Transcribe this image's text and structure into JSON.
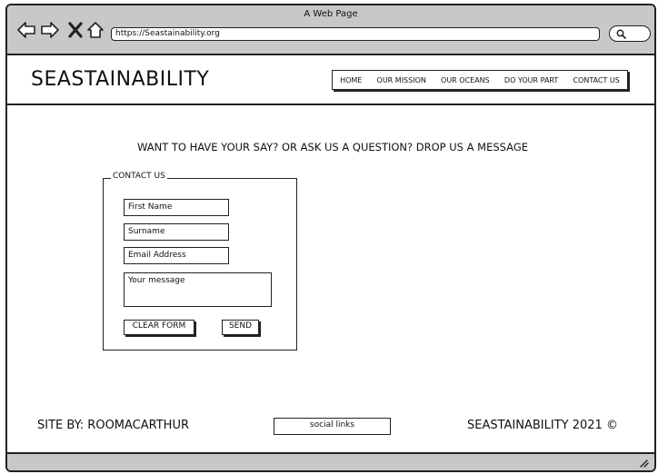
{
  "browser": {
    "title": "A Web Page",
    "url": "https://Seastainability.org"
  },
  "header": {
    "logo": "SEASTAINABILITY",
    "nav": [
      "HOME",
      "OUR MISSION",
      "OUR OCEANS",
      "DO YOUR PART",
      "CONTACT US"
    ]
  },
  "main": {
    "prompt": "WANT TO HAVE YOUR SAY? OR ASK US A QUESTION? DROP US A MESSAGE",
    "form": {
      "legend": "CONTACT US",
      "first_name_placeholder": "First Name",
      "surname_placeholder": "Surname",
      "email_placeholder": "Email Address",
      "message_placeholder": "Your message",
      "clear_label": "CLEAR FORM",
      "send_label": "SEND"
    }
  },
  "footer": {
    "site_by": "SITE BY: ROOMACARTHUR",
    "social": "social links",
    "copyright": "SEASTAINABILITY 2021 ©"
  },
  "icons": [
    "back-arrow-icon",
    "forward-arrow-icon",
    "close-icon",
    "home-icon",
    "search-icon",
    "resize-handle-icon"
  ]
}
